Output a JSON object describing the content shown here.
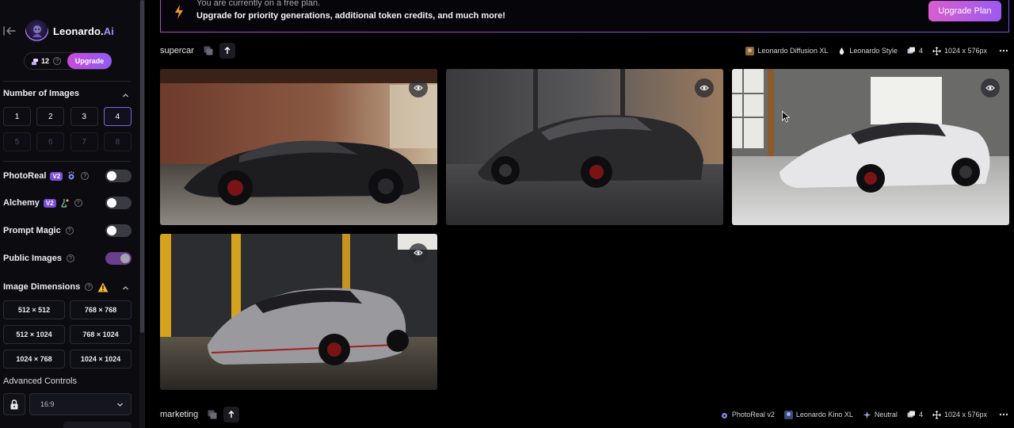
{
  "sidebar": {
    "brand": {
      "name_main": "Leonardo.",
      "name_accent": "Ai"
    },
    "tokens": {
      "count": "12",
      "upgrade_label": "Upgrade"
    },
    "number_of_images": {
      "title": "Number of Images",
      "options": [
        "1",
        "2",
        "3",
        "4",
        "5",
        "6",
        "7",
        "8"
      ],
      "selected": "4"
    },
    "photoreal": {
      "label": "PhotoReal",
      "badge": "V2",
      "enabled": false
    },
    "alchemy": {
      "label": "Alchemy",
      "badge": "V2",
      "enabled": false
    },
    "prompt_magic": {
      "label": "Prompt Magic",
      "enabled": false
    },
    "public_images": {
      "label": "Public Images",
      "enabled": true
    },
    "image_dimensions": {
      "title": "Image Dimensions",
      "options": [
        "512 × 512",
        "768 × 768",
        "512 × 1024",
        "768 × 1024",
        "1024 × 768",
        "1024 × 1024"
      ]
    },
    "advanced_controls": {
      "label": "Advanced Controls",
      "aspect_ratio": "16:9"
    }
  },
  "banner": {
    "line1": "You are currently on a free plan.",
    "line2": "Upgrade for priority generations, additional token credits, and much more!",
    "button_label": "Upgrade Plan"
  },
  "generations": [
    {
      "prompt": "supercar",
      "meta": {
        "model": "Leonardo Diffusion XL",
        "style": "Leonardo Style",
        "count": "4",
        "size": "1024 x 576px"
      }
    },
    {
      "prompt": "marketing",
      "meta": {
        "photoreal": "PhotoReal v2",
        "model": "Leonardo Kino XL",
        "style": "Neutral",
        "count": "4",
        "size": "1024 x 576px"
      }
    }
  ],
  "colors": {
    "accent": "#8f5cf2",
    "accent_pink": "#d85ed0",
    "background": "#000000",
    "sidebar": "#0b0b10"
  }
}
